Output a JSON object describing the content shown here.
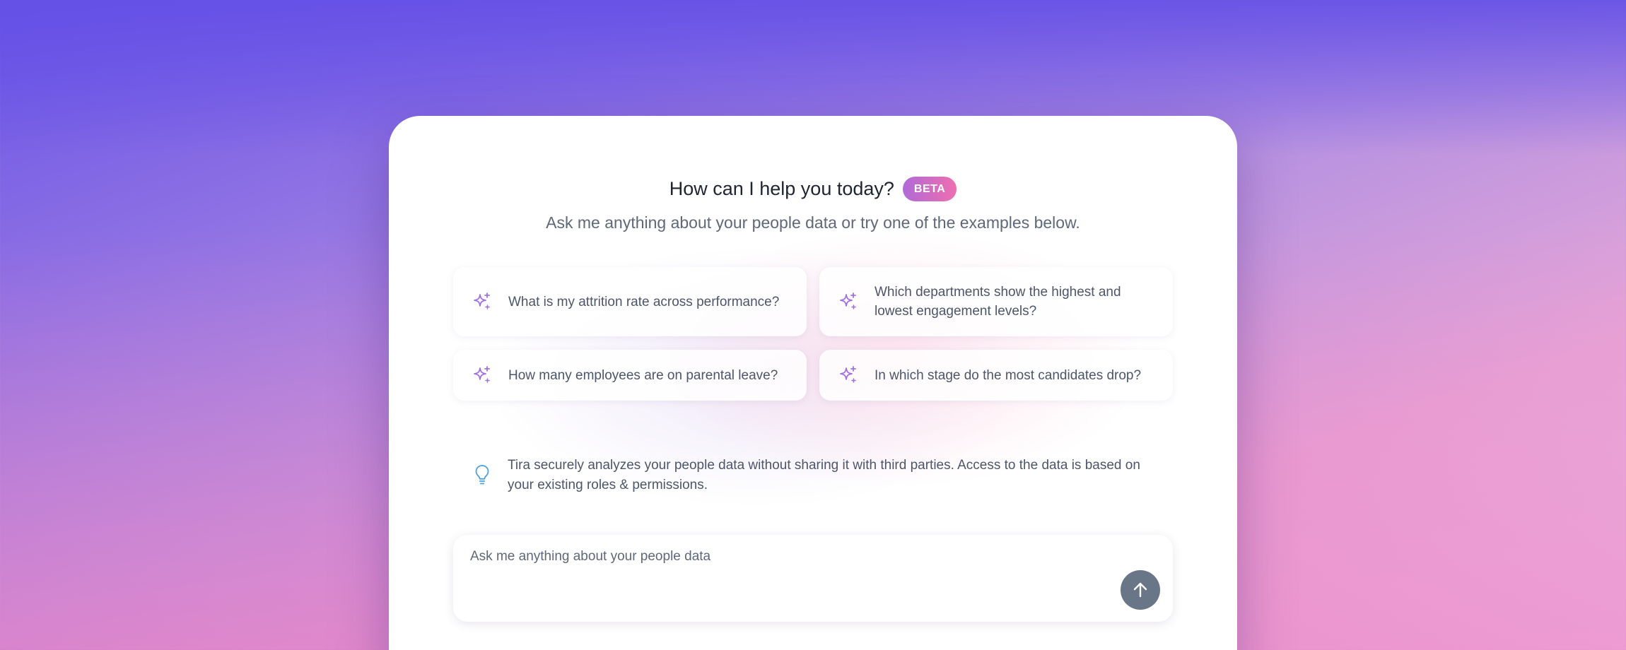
{
  "header": {
    "title": "How can I help you today?",
    "badge": "BETA",
    "subtitle": "Ask me anything about your people data or try one of the examples below."
  },
  "suggestions": [
    {
      "icon": "sparkle-icon",
      "label": "What is my attrition rate across performance?"
    },
    {
      "icon": "sparkle-icon",
      "label": "Which departments show the highest and lowest engagement levels?"
    },
    {
      "icon": "sparkle-icon",
      "label": "How many employees are on parental leave?"
    },
    {
      "icon": "sparkle-icon",
      "label": "In which stage do the most candidates drop?"
    }
  ],
  "info": {
    "icon": "lightbulb-icon",
    "text": "Tira securely analyzes your people data without sharing it with third parties. Access to the data is based on your existing roles & permissions."
  },
  "composer": {
    "placeholder": "Ask me anything about your people data",
    "value": "",
    "send_icon": "arrow-up-icon"
  },
  "colors": {
    "accent_purple": "#a070e0",
    "badge_start": "#b06ad6",
    "badge_end": "#ef6eb0",
    "send_button": "#687688",
    "info_icon": "#4aa3e0"
  }
}
